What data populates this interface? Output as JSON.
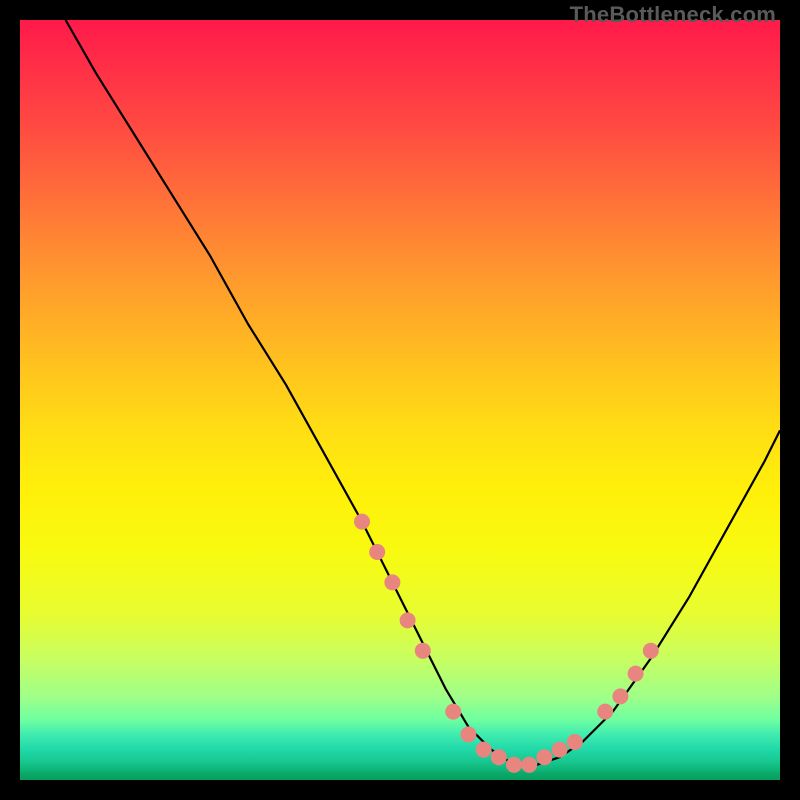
{
  "watermark": "TheBottleneck.com",
  "chart_data": {
    "type": "line",
    "title": "",
    "xlabel": "",
    "ylabel": "",
    "xlim": [
      0,
      100
    ],
    "ylim": [
      0,
      100
    ],
    "grid": false,
    "legend": false,
    "series": [
      {
        "name": "bottleneck-curve",
        "color": "#000000",
        "x": [
          6,
          10,
          15,
          20,
          25,
          30,
          35,
          40,
          45,
          50,
          53,
          56,
          59,
          62,
          65,
          68,
          71,
          74,
          78,
          83,
          88,
          93,
          98,
          100
        ],
        "y": [
          100,
          93,
          85,
          77,
          69,
          60,
          52,
          43,
          34,
          24,
          18,
          12,
          7,
          4,
          2,
          2,
          3,
          5,
          9,
          16,
          24,
          33,
          42,
          46
        ]
      }
    ],
    "markers": [
      {
        "name": "highlight-dots",
        "color": "#e9857f",
        "radius_px": 8,
        "points": [
          {
            "x": 45,
            "y": 34
          },
          {
            "x": 47,
            "y": 30
          },
          {
            "x": 49,
            "y": 26
          },
          {
            "x": 51,
            "y": 21
          },
          {
            "x": 53,
            "y": 17
          },
          {
            "x": 57,
            "y": 9
          },
          {
            "x": 59,
            "y": 6
          },
          {
            "x": 61,
            "y": 4
          },
          {
            "x": 63,
            "y": 3
          },
          {
            "x": 65,
            "y": 2
          },
          {
            "x": 67,
            "y": 2
          },
          {
            "x": 69,
            "y": 3
          },
          {
            "x": 71,
            "y": 4
          },
          {
            "x": 73,
            "y": 5
          },
          {
            "x": 77,
            "y": 9
          },
          {
            "x": 79,
            "y": 11
          },
          {
            "x": 81,
            "y": 14
          },
          {
            "x": 83,
            "y": 17
          }
        ]
      }
    ],
    "background_gradient": {
      "top": "#ff1a4a",
      "mid": "#ffde14",
      "bottom": "#06a060"
    }
  }
}
